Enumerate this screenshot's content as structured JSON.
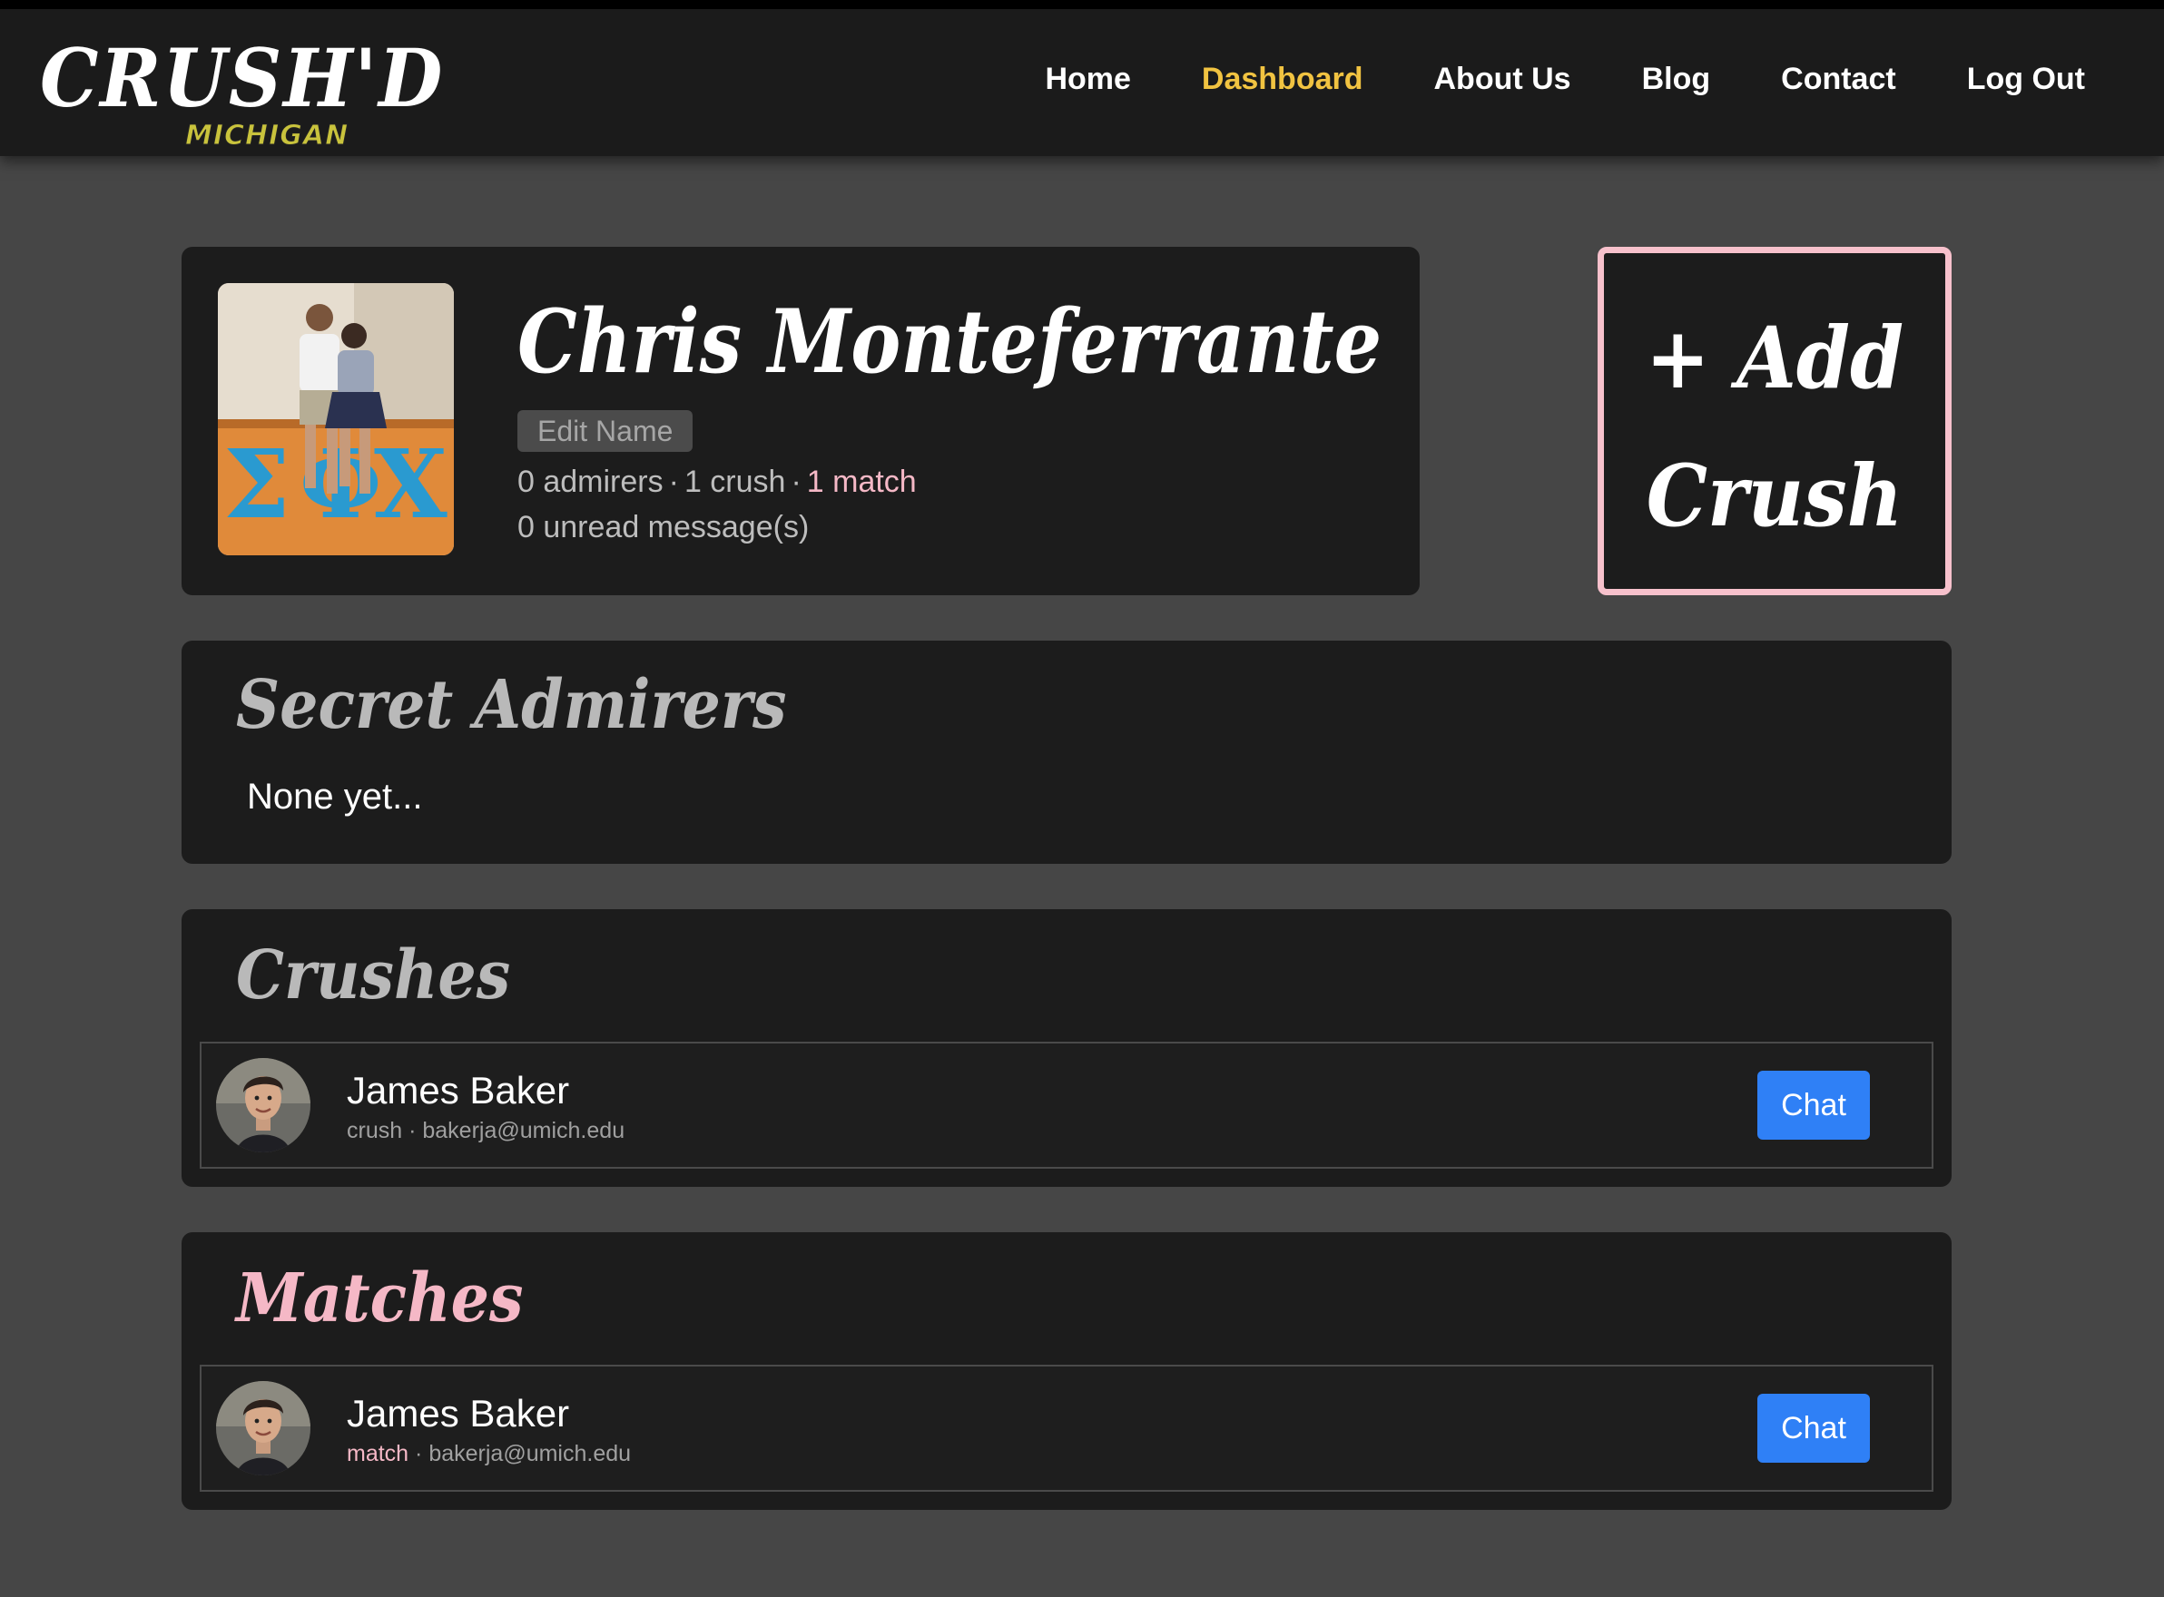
{
  "brand": {
    "logo_text": "CRUSH'D",
    "logo_subtext": "MICHIGAN",
    "accent_color": "#f1c341",
    "pink_color": "#f5b8c6",
    "chat_button_color": "#2f80f6"
  },
  "nav": {
    "items": [
      {
        "label": "Home",
        "active": false
      },
      {
        "label": "Dashboard",
        "active": true
      },
      {
        "label": "About Us",
        "active": false
      },
      {
        "label": "Blog",
        "active": false
      },
      {
        "label": "Contact",
        "active": false
      },
      {
        "label": "Log Out",
        "active": false
      }
    ]
  },
  "profile": {
    "name": "Chris Monteferrante",
    "edit_label": "Edit Name",
    "admirers": "0 admirers",
    "crushes": "1 crush",
    "matches": "1 match",
    "separator": "·",
    "unread": "0 unread message(s)"
  },
  "add_crush": {
    "line1": "+ Add",
    "line2": "Crush"
  },
  "admirers_section": {
    "title": "Secret Admirers",
    "empty_text": "None yet..."
  },
  "crushes_section": {
    "title": "Crushes",
    "items": [
      {
        "name": "James Baker",
        "type": "crush",
        "separator": "·",
        "email": "bakerja@umich.edu",
        "chat_label": "Chat"
      }
    ]
  },
  "matches_section": {
    "title": "Matches",
    "items": [
      {
        "name": "James Baker",
        "type": "match",
        "separator": "·",
        "email": "bakerja@umich.edu",
        "chat_label": "Chat"
      }
    ]
  }
}
